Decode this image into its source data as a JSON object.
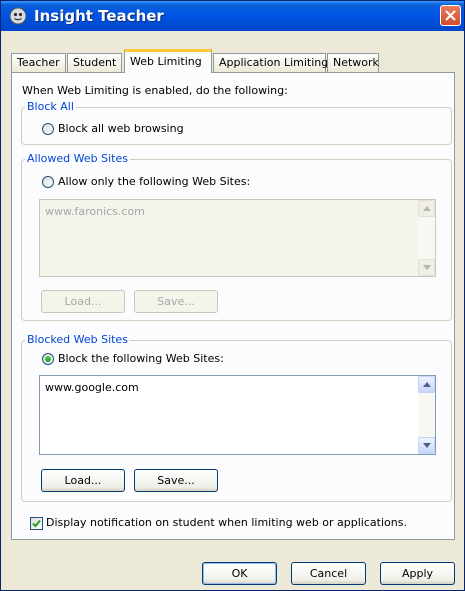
{
  "window": {
    "title": "Insight Teacher"
  },
  "tabs": [
    "Teacher",
    "Student",
    "Web Limiting",
    "Application Limiting",
    "Network"
  ],
  "active_tab": "Web Limiting",
  "intro": "When Web Limiting is enabled, do the following:",
  "block_all": {
    "group_label": "Block All",
    "radio_label": "Block all web browsing",
    "selected": false
  },
  "allowed": {
    "group_label": "Allowed Web Sites",
    "radio_label": "Allow only the following Web Sites:",
    "selected": false,
    "list_text": "www.faronics.com",
    "load_label": "Load...",
    "save_label": "Save..."
  },
  "blocked": {
    "group_label": "Blocked Web Sites",
    "radio_label": "Block the following Web Sites:",
    "selected": true,
    "list_text": "www.google.com",
    "load_label": "Load...",
    "save_label": "Save..."
  },
  "notify": {
    "label": "Display notification on student when limiting web or applications.",
    "checked": true
  },
  "footer": {
    "ok": "OK",
    "cancel": "Cancel",
    "apply": "Apply"
  },
  "colors": {
    "title_bar": "#0055e5",
    "group_label": "#0046d5",
    "active_tab_accent": "#ffc83c"
  }
}
